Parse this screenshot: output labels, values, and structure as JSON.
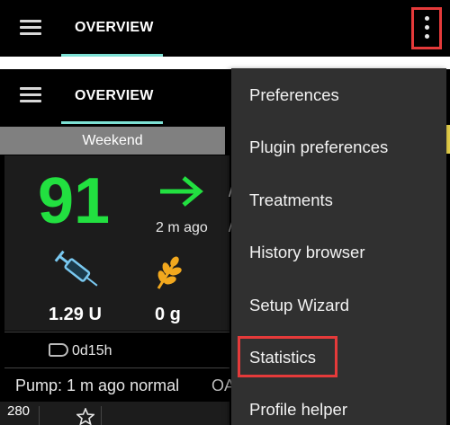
{
  "app_bar": {
    "title": "OVERVIEW"
  },
  "overview": {
    "profile_label": "Weekend",
    "bg_value": "91",
    "bg_age": "2 m ago",
    "iob": "1.29 U",
    "cob": "0 g",
    "cannula_age": "0d15h",
    "pump_status": "Pump: 1 m ago normal",
    "graph_label": "280"
  },
  "overflow_menu": {
    "items": [
      "Preferences",
      "Plugin preferences",
      "Treatments",
      "History browser",
      "Setup Wizard",
      "Statistics",
      "Profile helper"
    ]
  },
  "colors": {
    "bg_in_range": "#22e040",
    "tab_indicator": "#7de0d4",
    "highlight": "#e53a3a",
    "wheat": "#f2a81e",
    "syringe": "#79c8f0"
  }
}
